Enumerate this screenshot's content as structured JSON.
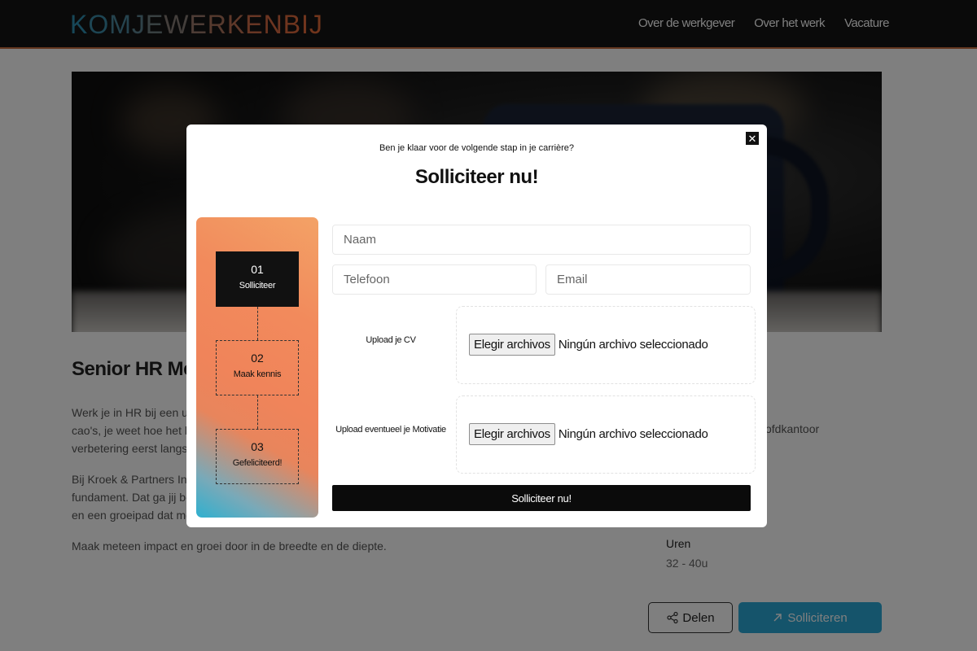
{
  "header": {
    "logo_letters": [
      {
        "char": "K",
        "color": "#2e8fb0"
      },
      {
        "char": "O",
        "color": "#3a8aa6"
      },
      {
        "char": "M",
        "color": "#4a869c"
      },
      {
        "char": "J",
        "color": "#5d8390"
      },
      {
        "char": "E",
        "color": "#718083"
      },
      {
        "char": "W",
        "color": "#867c76"
      },
      {
        "char": "E",
        "color": "#9a786a"
      },
      {
        "char": "R",
        "color": "#ad745d"
      },
      {
        "char": "K",
        "color": "#bf7052"
      },
      {
        "char": "E",
        "color": "#ce6d49"
      },
      {
        "char": "N",
        "color": "#d96b42"
      },
      {
        "char": "B",
        "color": "#df6a3d"
      },
      {
        "char": "I",
        "color": "#e26a3a"
      },
      {
        "char": "J",
        "color": "#e36a39"
      }
    ],
    "nav": [
      "Over de werkgever",
      "Over het werk",
      "Vacature"
    ]
  },
  "page": {
    "job_title": "Senior HR Me",
    "paragraph_1": "Werk je in HR bij een uit\ncao's, je weet hoe het be\nverbetering eerst langs e",
    "paragraph_2": "Bij Kroek & Partners Inte\nfundament. Dat ga jij bo\nen een groeipad dat me",
    "paragraph_3": "Maak meteen impact en groei door in de breedte en de diepte.",
    "side_fragment": "ofdkantoor",
    "hours_label": "Uren",
    "hours_value": "32 - 40u",
    "share_label": "Delen",
    "apply_label": "Solliciteren"
  },
  "modal": {
    "subtitle": "Ben je klaar voor de volgende stap in je carrière?",
    "title": "Solliciteer nu!",
    "close_symbol": "✕",
    "steps": [
      {
        "num": "01",
        "label": "Solliciteer",
        "active": true
      },
      {
        "num": "02",
        "label": "Maak kennis",
        "active": false
      },
      {
        "num": "03",
        "label": "Gefeliciteerd!",
        "active": false
      }
    ],
    "fields": {
      "name_placeholder": "Naam",
      "phone_placeholder": "Telefoon",
      "email_placeholder": "Email"
    },
    "uploads": [
      {
        "label": "Upload je CV",
        "button": "Elegir archivos",
        "status": "Ningún archivo seleccionado"
      },
      {
        "label": "Upload eventueel je Motivatie",
        "button": "Elegir archivos",
        "status": "Ningún archivo seleccionado"
      }
    ],
    "submit_label": "Solliciteer nu!"
  },
  "colors": {
    "accent_orange": "#f28a5c",
    "accent_blue": "#2aa8d6",
    "dark": "#0b0b0b"
  }
}
